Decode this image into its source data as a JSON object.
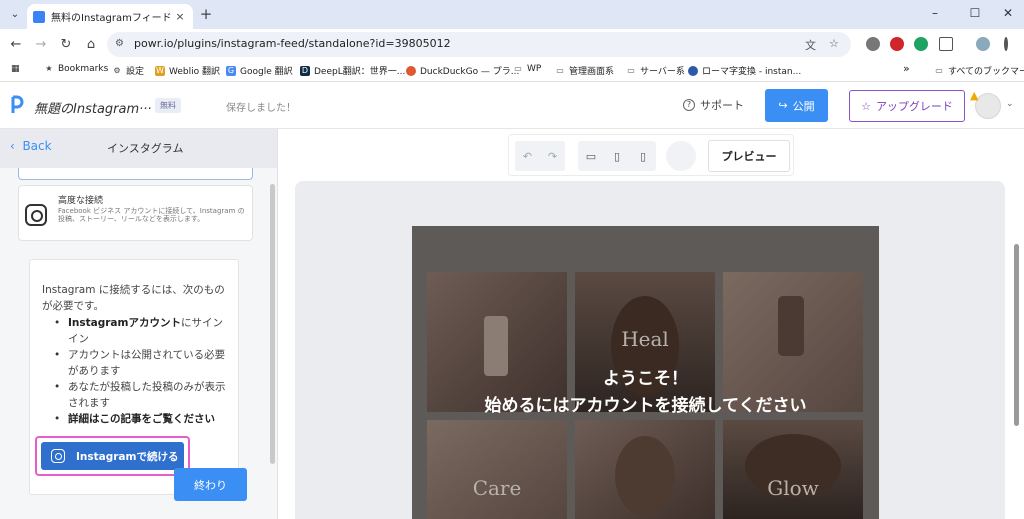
{
  "browser": {
    "tab_title": "無料のInstagramフィードソフトウェア",
    "tab_close": "×",
    "new_tab": "+",
    "url": "powr.io/plugins/instagram-feed/standalone?id=39805012",
    "bookmarks": [
      "Bookmarks",
      "設定",
      "Weblio 翻訳",
      "Google 翻訳",
      "DeepL翻訳：世界一...",
      "DuckDuckGo — プラ...",
      "WP",
      "管理画面系",
      "サーバー系",
      "ローマ字変換 - instan...",
      "»",
      "すべてのブックマーク"
    ]
  },
  "header": {
    "doc_title": "無題のInstagram···",
    "plan_badge": "無料",
    "save_status": "保存しました！",
    "support": "サポート",
    "publish": "公開",
    "upgrade": "アップグレード"
  },
  "sidebar": {
    "back": "Back",
    "title": "インスタグラム",
    "advanced": {
      "title": "高度な接続",
      "desc": "Facebook ビジネス アカウントに接続して、Instagram の投稿、ストーリー、リールなどを表示します。"
    },
    "lead": "Instagram に接続するには、次のものが必要です。",
    "requirements": [
      {
        "bold": "Instagramアカウント",
        "text": "にサインイン"
      },
      {
        "bold": "",
        "text": "アカウントは公開されている必要があります"
      },
      {
        "bold": "",
        "text": "あなたが投稿した投稿のみが表示されます"
      },
      {
        "bold": "詳細はこの記事をご覧ください",
        "prefix": "詳細はこの",
        "text": ""
      }
    ],
    "connect_button": "Instagramで続ける",
    "done_button": "終わり"
  },
  "canvas": {
    "preview_button": "プレビュー",
    "welcome_line1": "ようこそ！",
    "welcome_line2": "始めるにはアカウントを接続してください",
    "photo_labels": [
      "Heal",
      "Care",
      "Glow"
    ]
  },
  "colors": {
    "accent": "#3b8ff4",
    "upgrade": "#7a3fbf",
    "highlight": "#e95ec6",
    "ig_button": "#2f6fce"
  }
}
